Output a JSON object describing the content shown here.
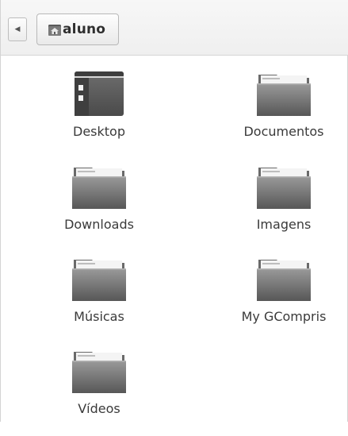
{
  "toolbar": {
    "back_icon": "left-arrow-icon",
    "path_icon": "home-folder-icon",
    "path_label": "aluno"
  },
  "items": [
    {
      "label": "Desktop",
      "icon": "desktop-folder-icon"
    },
    {
      "label": "Documentos",
      "icon": "folder-icon"
    },
    {
      "label": "Downloads",
      "icon": "folder-icon"
    },
    {
      "label": "Imagens",
      "icon": "folder-icon"
    },
    {
      "label": "Músicas",
      "icon": "folder-icon"
    },
    {
      "label": "My GCompris",
      "icon": "folder-icon"
    },
    {
      "label": "Vídeos",
      "icon": "folder-icon"
    }
  ],
  "colors": {
    "folder_dark": "#5d5d5d",
    "folder_light": "#8c8c8c",
    "paper": "#f2f2f2"
  }
}
